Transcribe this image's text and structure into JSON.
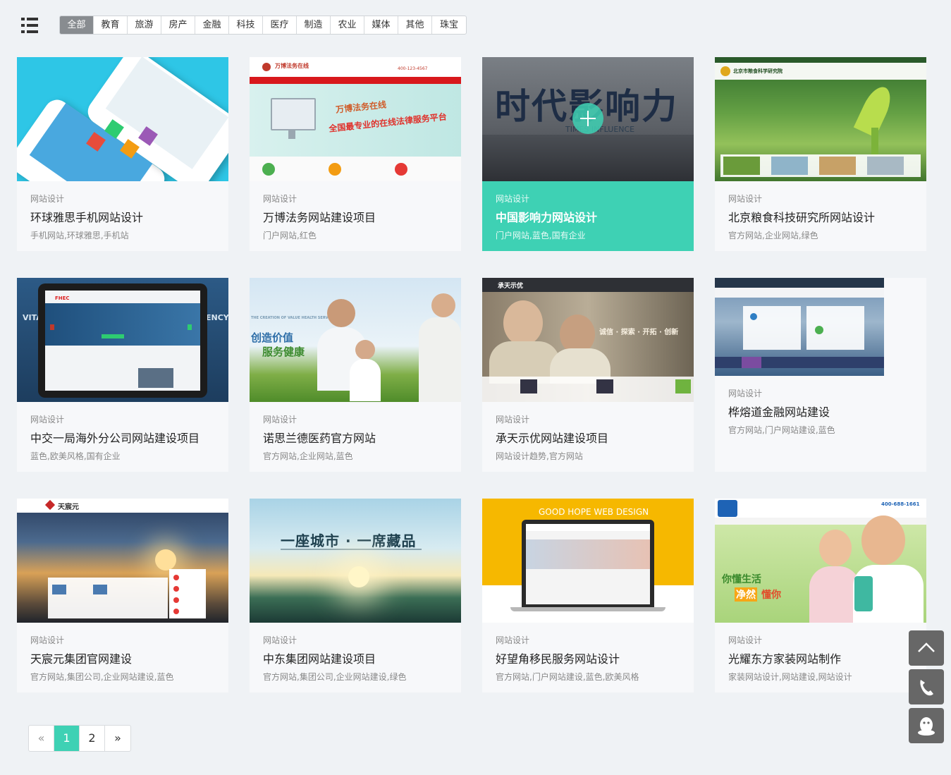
{
  "filters": [
    "全部",
    "教育",
    "旅游",
    "房产",
    "金融",
    "科技",
    "医疗",
    "制造",
    "农业",
    "媒体",
    "其他",
    "珠宝"
  ],
  "cards": [
    {
      "category": "网站设计",
      "title": "环球雅思手机网站设计",
      "tags": "手机网站,环球雅思,手机站"
    },
    {
      "category": "网站设计",
      "title": "万博法务网站建设项目",
      "tags": "门户网站,红色"
    },
    {
      "category": "网站设计",
      "title": "中国影响力网站设计",
      "tags": "门户网站,蓝色,国有企业"
    },
    {
      "category": "网站设计",
      "title": "北京粮食科技研究所网站设计",
      "tags": "官方网站,企业网站,绿色"
    },
    {
      "category": "网站设计",
      "title": "中交一局海外分公司网站建设项目",
      "tags": "蓝色,欧美风格,国有企业"
    },
    {
      "category": "网站设计",
      "title": "诺思兰德医药官方网站",
      "tags": "官方网站,企业网站,蓝色"
    },
    {
      "category": "网站设计",
      "title": "承天示优网站建设项目",
      "tags": "网站设计趋势,官方网站"
    },
    {
      "category": "网站设计",
      "title": "桦熔道金融网站建设",
      "tags": "官方网站,门户网站建设,蓝色"
    },
    {
      "category": "网站设计",
      "title": "天宸元集团官网建设",
      "tags": "官方网站,集团公司,企业网站建设,蓝色"
    },
    {
      "category": "网站设计",
      "title": "中东集团网站建设项目",
      "tags": "官方网站,集团公司,企业网站建设,绿色"
    },
    {
      "category": "网站设计",
      "title": "好望角移民服务网站设计",
      "tags": "官方网站,门户网站建设,蓝色,欧美风格"
    },
    {
      "category": "网站设计",
      "title": "光耀东方家装网站制作",
      "tags": "家装网站设计,网站建设,网站设计"
    }
  ],
  "thumb_text": {
    "wanbo_site": "万博法务在线",
    "wanbo_phone": "400-123-4567",
    "wanbo_slogan1": "万博法务在线",
    "wanbo_slogan2": "全国最专业的在线法律服务平台",
    "influence_cn": "时代影响力",
    "influence_en": "TIMES INFLUENCE",
    "grain_site": "北京市粮食科学研究院",
    "fhec": "FHEC",
    "vita": "VITA",
    "ency": "ENCY",
    "nuosi_line1": "创造价值",
    "nuosi_line2": "服务健康",
    "nuosi_en": "THE CREATION OF VALUE HEALTH SERVICE",
    "chengtian_logo": "承天示优",
    "chengtian_slogan": "诚信 · 探索 · 开拓 · 创新",
    "tianchen_logo": "天宸元",
    "zhongdong_title": "一座城市 · 一席藏品",
    "goodhope_title": "GOOD HOPE WEB DESIGN",
    "gy_phone": "400-688-1661",
    "gy_line1": "你懂生活",
    "gy_line2a": "净然",
    "gy_line2b": "懂你"
  },
  "pagination": {
    "prev": "«",
    "pages": [
      "1",
      "2"
    ],
    "current": "1",
    "next": "»"
  },
  "colors": {
    "accent": "#3ed1b4",
    "background": "#eff2f5",
    "tool": "#676767"
  },
  "tools": [
    "back-to-top-icon",
    "phone-icon",
    "qq-icon"
  ]
}
